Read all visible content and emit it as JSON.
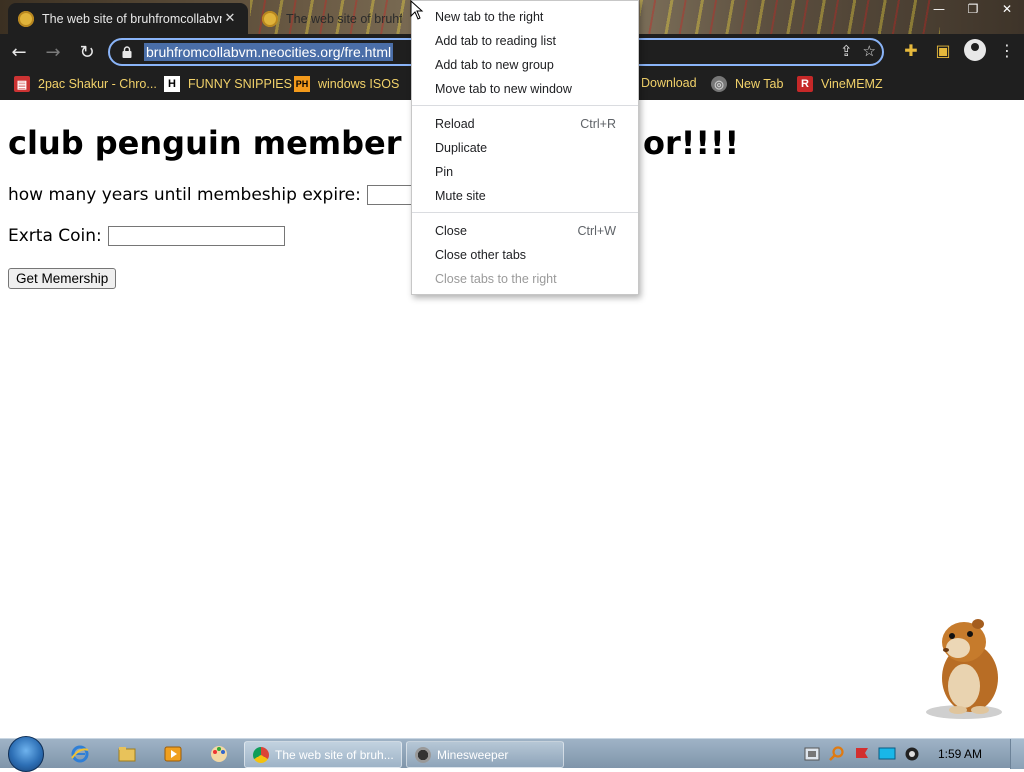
{
  "browser": {
    "tabs": [
      {
        "title": "The web site of bruhfromcollabvm",
        "active": true
      },
      {
        "title": "The web site of bruhfromcollabvm",
        "active": false
      }
    ],
    "url": "bruhfromcollabvm.neocities.org/fre.html",
    "bookmarks": [
      {
        "label": "2pac Shakur - Chro...",
        "icon": "shopping-bag-icon"
      },
      {
        "label": "FUNNY SNIPPIES",
        "icon": "h-logo-icon"
      },
      {
        "label": "windows ISOS",
        "icon": "ph-logo-icon"
      },
      {
        "label": "Download",
        "icon": ""
      },
      {
        "label": "New Tab",
        "icon": "globe-icon"
      },
      {
        "label": "VineMEMZ",
        "icon": "r-logo-icon"
      }
    ]
  },
  "page": {
    "heading": "club penguin member",
    "heading_tail": "or!!!!",
    "years_label": "how many years until membeship expire:",
    "coin_label": "Exrta Coin:",
    "submit_label": "Get Memership"
  },
  "context_menu": {
    "groups": [
      [
        {
          "label": "New tab to the right",
          "shortcut": ""
        },
        {
          "label": "Add tab to reading list",
          "shortcut": ""
        },
        {
          "label": "Add tab to new group",
          "shortcut": ""
        },
        {
          "label": "Move tab to new window",
          "shortcut": ""
        }
      ],
      [
        {
          "label": "Reload",
          "shortcut": "Ctrl+R"
        },
        {
          "label": "Duplicate",
          "shortcut": ""
        },
        {
          "label": "Pin",
          "shortcut": ""
        },
        {
          "label": "Mute site",
          "shortcut": ""
        }
      ],
      [
        {
          "label": "Close",
          "shortcut": "Ctrl+W"
        },
        {
          "label": "Close other tabs",
          "shortcut": ""
        },
        {
          "label": "Close tabs to the right",
          "shortcut": "",
          "disabled": true
        }
      ]
    ]
  },
  "taskbar": {
    "windows": [
      {
        "label": "The web site of bruh...",
        "icon": "chrome-icon"
      },
      {
        "label": "Minesweeper",
        "icon": "minesweeper-icon"
      }
    ],
    "clock": "1:59 AM"
  },
  "colors": {
    "chrome_dark": "#1f1f1f",
    "omnibox_focus": "#8ab4f8",
    "bookmark_text": "#f2d26a",
    "taskbar": "#9fb3c6"
  }
}
